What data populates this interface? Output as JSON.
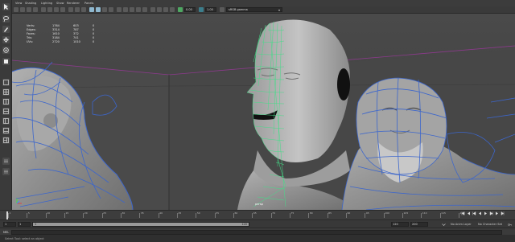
{
  "menubar": {
    "items": [
      "View",
      "Shading",
      "Lighting",
      "Show",
      "Renderer",
      "Panels"
    ]
  },
  "toolbar": {
    "field_a": "0.00",
    "field_b": "1.00",
    "color_space": "sRGB gamma"
  },
  "hud": {
    "rows": [
      {
        "label": "Verts:",
        "v1": "1764",
        "v2": "603",
        "v3": "0"
      },
      {
        "label": "Edges:",
        "v1": "3314",
        "v2": "787",
        "v3": "0"
      },
      {
        "label": "Faces:",
        "v1": "1610",
        "v2": "372",
        "v3": "0"
      },
      {
        "label": "Tris:",
        "v1": "3184",
        "v2": "741",
        "v3": "0"
      },
      {
        "label": "UVs:",
        "v1": "2720",
        "v2": "1010",
        "v3": "0"
      }
    ]
  },
  "viewport": {
    "camera_label": "persp"
  },
  "timeline": {
    "ticks": [
      "1",
      "5",
      "10",
      "15",
      "20",
      "25",
      "30",
      "35",
      "40",
      "45",
      "50",
      "55",
      "60",
      "65",
      "70",
      "75",
      "80",
      "85",
      "90",
      "95",
      "100",
      "105",
      "110",
      "115",
      "120"
    ]
  },
  "range": {
    "start": "1",
    "inner_start": "1",
    "slider_left": "1",
    "slider_right": "120",
    "inner_end": "120",
    "end_a": "120",
    "end_b": "200",
    "anim_layer": "No Anim Layer",
    "char_set": "No Character Set",
    "frame": "1"
  },
  "command": {
    "mel_label": "MEL"
  },
  "help": {
    "text": "Select Tool: select an object"
  },
  "colors": {
    "wireframe": "#3c66cc",
    "selection": "#44dd88",
    "accent": "#8fb8cf"
  }
}
